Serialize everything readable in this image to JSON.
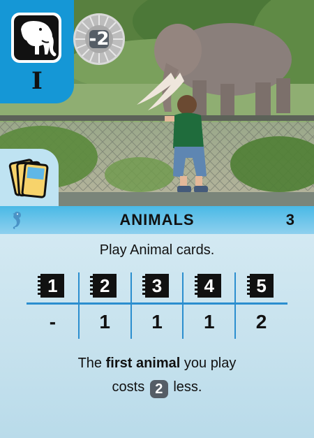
{
  "header": {
    "icon": "elephant-icon",
    "level": "I",
    "coin_value": "-2",
    "card_stack_icon": "card-stack-icon"
  },
  "bar": {
    "icon": "seahorse-icon",
    "title": "ANIMALS",
    "number": "3"
  },
  "description": "Play Animal cards.",
  "table": {
    "headers": [
      "1",
      "2",
      "3",
      "4",
      "5"
    ],
    "values": [
      "-",
      "1",
      "1",
      "1",
      "2"
    ]
  },
  "effect": {
    "line1_prefix": "The ",
    "line1_bold": "first animal",
    "line1_suffix": " you play",
    "line2_prefix": "costs ",
    "line2_badge": "2",
    "line2_suffix": " less."
  },
  "colors": {
    "corner_blue": "#1597d6",
    "bar_blue": "#49b9e6",
    "table_line": "#2b8ecf",
    "body_bg": "#c9e2ec"
  }
}
